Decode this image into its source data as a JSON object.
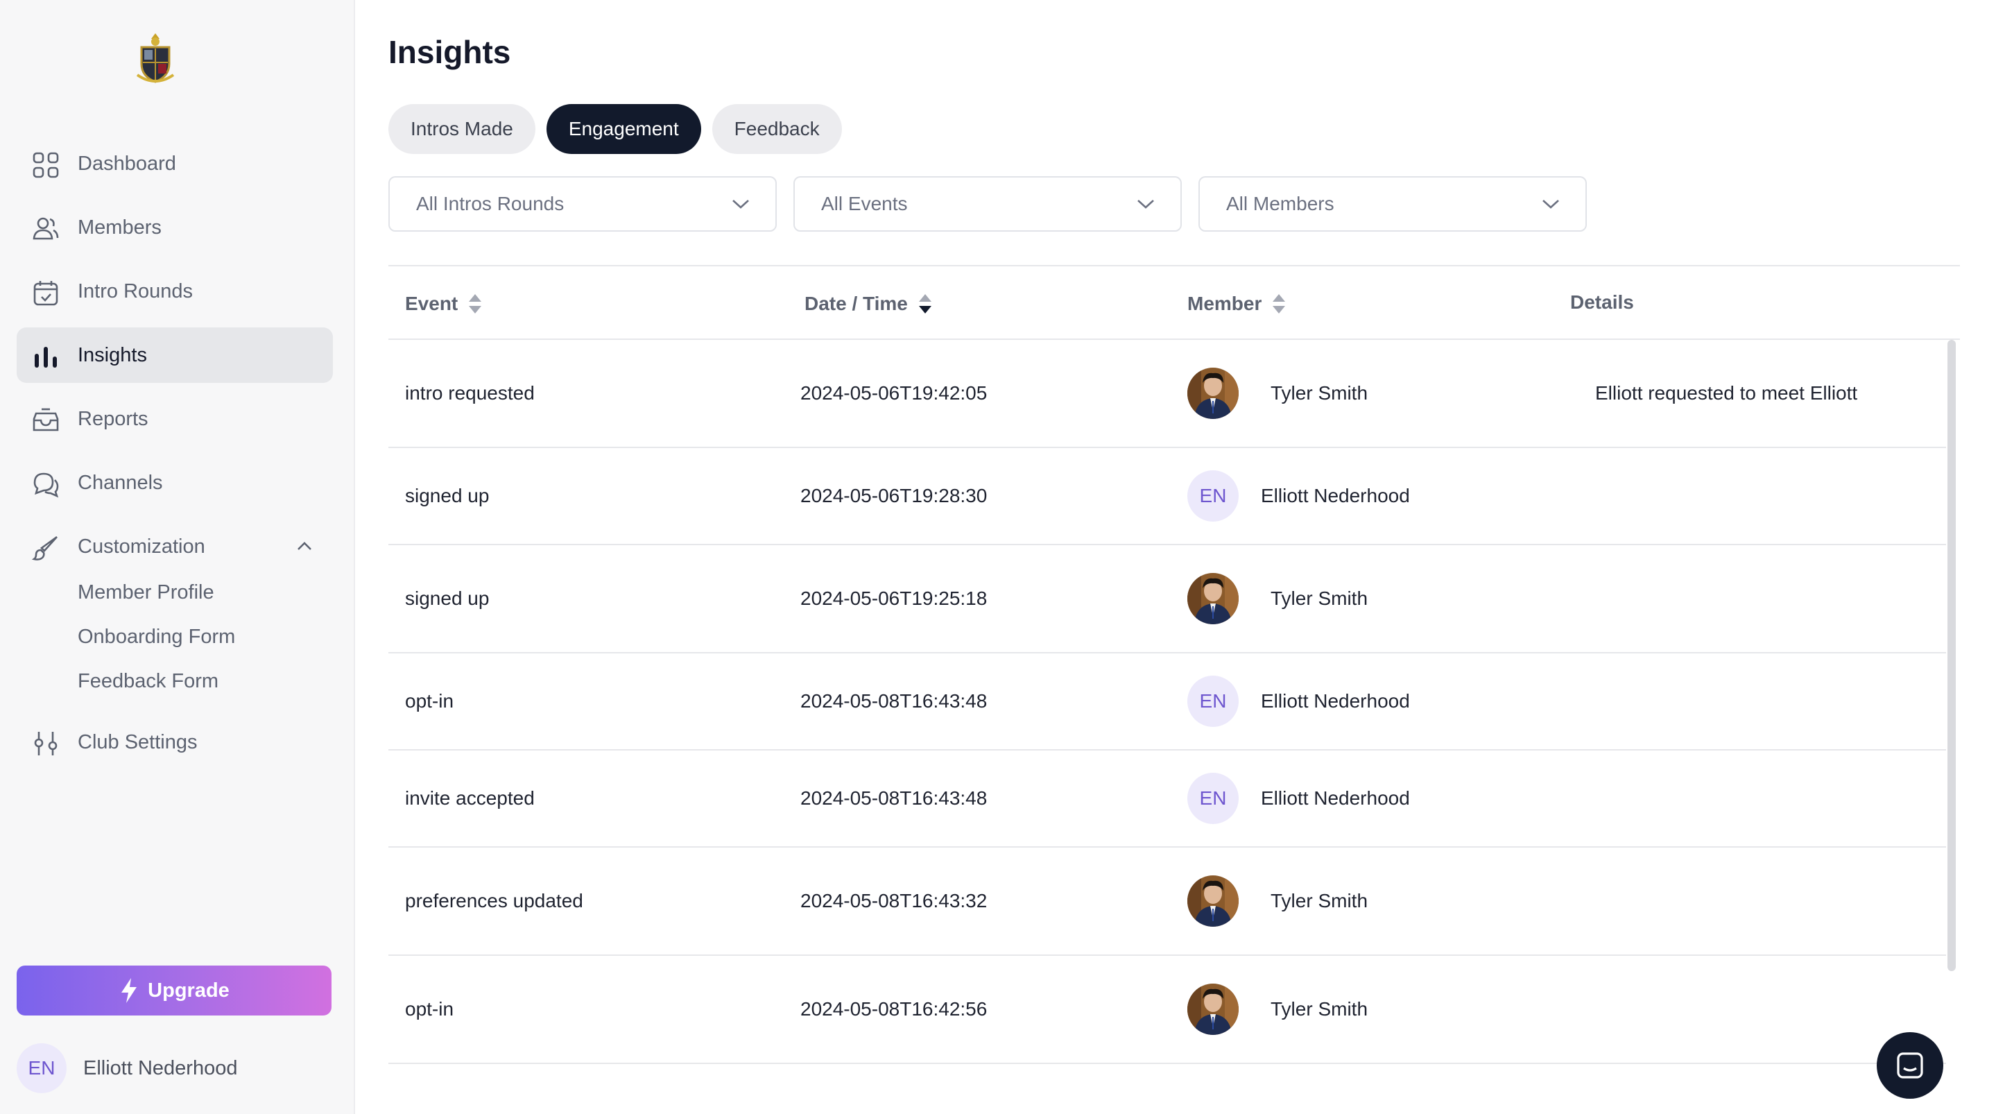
{
  "sidebar": {
    "nav": [
      {
        "label": "Dashboard",
        "icon": "dashboard-grid-icon"
      },
      {
        "label": "Members",
        "icon": "members-icon"
      },
      {
        "label": "Intro Rounds",
        "icon": "calendar-check-icon"
      },
      {
        "label": "Insights",
        "icon": "bar-chart-icon",
        "active": true
      },
      {
        "label": "Reports",
        "icon": "inbox-tray-icon"
      },
      {
        "label": "Channels",
        "icon": "chat-bubbles-icon"
      },
      {
        "label": "Customization",
        "icon": "paintbrush-icon",
        "expanded": true
      }
    ],
    "customization_sub": [
      "Member Profile",
      "Onboarding Form",
      "Feedback Form"
    ],
    "club_settings": {
      "label": "Club Settings",
      "icon": "sliders-icon"
    },
    "upgrade_label": "Upgrade",
    "user": {
      "initials": "EN",
      "name": "Elliott Nederhood"
    }
  },
  "main": {
    "title": "Insights",
    "tabs": [
      {
        "label": "Intros Made",
        "active": false
      },
      {
        "label": "Engagement",
        "active": true
      },
      {
        "label": "Feedback",
        "active": false
      }
    ],
    "filters": [
      {
        "value": "All Intros Rounds"
      },
      {
        "value": "All Events"
      },
      {
        "value": "All Members"
      }
    ],
    "table": {
      "columns": [
        "Event",
        "Date / Time",
        "Member",
        "Details"
      ],
      "rows": [
        {
          "event": "intro requested",
          "datetime": "2024-05-06T19:42:05",
          "member": "Tyler Smith",
          "avatar": "photo",
          "details": "Elliott requested to meet Elliott"
        },
        {
          "event": "signed up",
          "datetime": "2024-05-06T19:28:30",
          "member": "Elliott Nederhood",
          "avatar": "initials",
          "initials": "EN",
          "details": ""
        },
        {
          "event": "signed up",
          "datetime": "2024-05-06T19:25:18",
          "member": "Tyler Smith",
          "avatar": "photo",
          "details": ""
        },
        {
          "event": "opt-in",
          "datetime": "2024-05-08T16:43:48",
          "member": "Elliott Nederhood",
          "avatar": "initials",
          "initials": "EN",
          "details": ""
        },
        {
          "event": "invite accepted",
          "datetime": "2024-05-08T16:43:48",
          "member": "Elliott Nederhood",
          "avatar": "initials",
          "initials": "EN",
          "details": ""
        },
        {
          "event": "preferences updated",
          "datetime": "2024-05-08T16:43:32",
          "member": "Tyler Smith",
          "avatar": "photo",
          "details": ""
        },
        {
          "event": "opt-in",
          "datetime": "2024-05-08T16:42:56",
          "member": "Tyler Smith",
          "avatar": "photo",
          "details": ""
        }
      ]
    }
  },
  "colors": {
    "accent_dark": "#121a2c",
    "upgrade_gradient_start": "#7a63ec",
    "upgrade_gradient_end": "#d170e0",
    "initials_avatar_bg": "#ece9fb",
    "initials_avatar_fg": "#6e56cf"
  }
}
